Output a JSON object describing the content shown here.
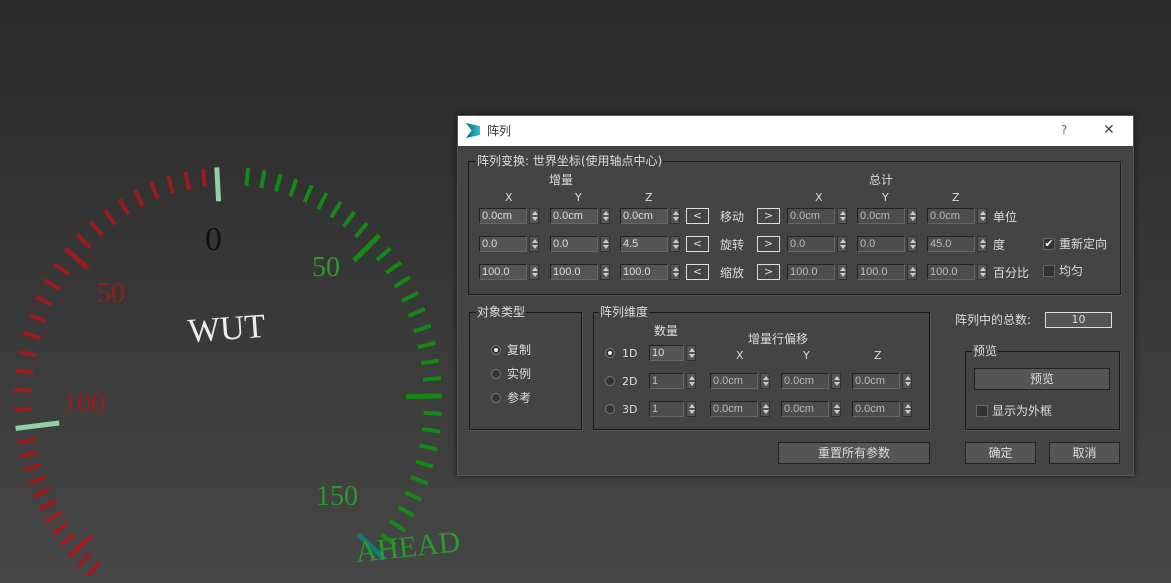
{
  "viewport": {
    "gauge": {
      "center_label": "WUT",
      "status_label": "AHEAD",
      "left_labels": [
        "50",
        "100"
      ],
      "right_labels": [
        "50",
        "150"
      ],
      "zero_label": "0",
      "left_color": "#9a1c1c",
      "right_color": "#138a13",
      "marker_color": "#8fd0a8"
    }
  },
  "dialog": {
    "title": "阵列",
    "help": "?",
    "close": "✕",
    "transform": {
      "legend": "阵列变换: 世界坐标(使用轴点中心)",
      "increment": "增量",
      "total": "总计",
      "axes": [
        "X",
        "Y",
        "Z"
      ],
      "rows": [
        {
          "label": "移动",
          "inc": [
            "0.0cm",
            "0.0cm",
            "0.0cm"
          ],
          "tot": [
            "0.0cm",
            "0.0cm",
            "0.0cm"
          ],
          "unit": "单位"
        },
        {
          "label": "旋转",
          "inc": [
            "0.0",
            "0.0",
            "4.5"
          ],
          "tot": [
            "0.0",
            "0.0",
            "45.0"
          ],
          "unit": "度"
        },
        {
          "label": "缩放",
          "inc": [
            "100.0",
            "100.0",
            "100.0"
          ],
          "tot": [
            "100.0",
            "100.0",
            "100.0"
          ],
          "unit": "百分比"
        }
      ],
      "left_arrow": "<",
      "right_arrow": ">",
      "reorient": {
        "label": "重新定向",
        "checked": true
      },
      "uniform": {
        "label": "均匀",
        "checked": false
      }
    },
    "object_type": {
      "legend": "对象类型",
      "options": [
        {
          "label": "复制",
          "selected": true
        },
        {
          "label": "实例",
          "selected": false
        },
        {
          "label": "参考",
          "selected": false
        }
      ]
    },
    "dimensions": {
      "legend": "阵列维度",
      "count_header": "数量",
      "offset_header": "增量行偏移",
      "axes": [
        "X",
        "Y",
        "Z"
      ],
      "rows": [
        {
          "label": "1D",
          "count": "10",
          "selected": true
        },
        {
          "label": "2D",
          "count": "1",
          "offsets": [
            "0.0cm",
            "0.0cm",
            "0.0cm"
          ]
        },
        {
          "label": "3D",
          "count": "1",
          "offsets": [
            "0.0cm",
            "0.0cm",
            "0.0cm"
          ]
        }
      ]
    },
    "total": {
      "label": "阵列中的总数:",
      "value": "10"
    },
    "preview": {
      "legend": "预览",
      "button": "预览",
      "box_label": "显示为外框",
      "box_checked": false
    },
    "reset": "重置所有参数",
    "ok": "确定",
    "cancel": "取消"
  }
}
